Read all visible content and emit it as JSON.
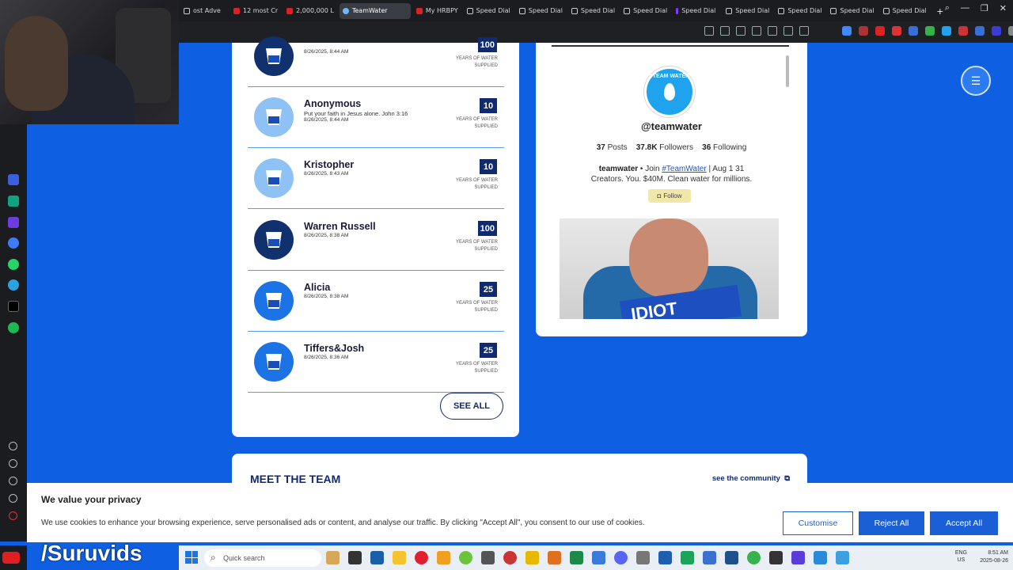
{
  "browser": {
    "tabs": [
      {
        "label": "ost Adve",
        "icon": "grid"
      },
      {
        "label": "12 most Cr",
        "icon": "red"
      },
      {
        "label": "2,000,000 L",
        "icon": "red"
      },
      {
        "label": "TeamWater",
        "icon": "blue",
        "active": true
      },
      {
        "label": "My HRBPY",
        "icon": "red"
      },
      {
        "label": "Speed Dial",
        "icon": "grid"
      },
      {
        "label": "Speed Dial",
        "icon": "grid"
      },
      {
        "label": "Speed Dial",
        "icon": "grid"
      },
      {
        "label": "Speed Dial",
        "icon": "grid"
      },
      {
        "label": "Speed Dial",
        "icon": "purple"
      },
      {
        "label": "Speed Dial",
        "icon": "grid"
      },
      {
        "label": "Speed Dial",
        "icon": "grid"
      },
      {
        "label": "Speed Dial",
        "icon": "grid"
      },
      {
        "label": "Speed Dial",
        "icon": "grid"
      }
    ],
    "new_tab": "+"
  },
  "donations": {
    "unit_label": "YEARS OF WATER SUPPLIED",
    "items": [
      {
        "name": "",
        "message": "",
        "date": "8/26/2025, 8:44 AM",
        "amount": "100",
        "avatar": "dark"
      },
      {
        "name": "Anonymous",
        "message": "Put your faith in Jesus alone. John 3:16",
        "date": "8/26/2025, 8:44 AM",
        "amount": "10",
        "avatar": "light"
      },
      {
        "name": "Kristopher",
        "message": "",
        "date": "8/26/2025, 8:43 AM",
        "amount": "10",
        "avatar": "light"
      },
      {
        "name": "Warren Russell",
        "message": "",
        "date": "8/26/2025, 8:38 AM",
        "amount": "100",
        "avatar": "dark"
      },
      {
        "name": "Alicia",
        "message": "",
        "date": "8/26/2025, 8:38 AM",
        "amount": "25",
        "avatar": "mid"
      },
      {
        "name": "Tiffers&Josh",
        "message": "",
        "date": "8/26/2025, 8:36 AM",
        "amount": "25",
        "avatar": "mid"
      }
    ],
    "see_all": "SEE ALL"
  },
  "instagram": {
    "logo_text": "#TEAM WATER",
    "handle": "@teamwater",
    "posts": "37",
    "posts_label": "Posts",
    "followers": "37.8K",
    "followers_label": "Followers",
    "following": "36",
    "following_label": "Following",
    "bio_name": "teamwater",
    "bio_join": " • Join ",
    "bio_tag": "#TeamWater",
    "bio_dates": " | Aug 1 31",
    "bio_line2": "Creators. You. $40M. Clean water for millions.",
    "follow_label": "Follow",
    "photo_sign": "IDIOT"
  },
  "team": {
    "title": "MEET THE TEAM",
    "link": "see the community"
  },
  "cookie": {
    "title": "We value your privacy",
    "text": "We use cookies to enhance your browsing experience, serve personalised ads or content, and analyse our traffic. By clicking \"Accept All\", you consent to our use of cookies.",
    "customise": "Customise",
    "reject": "Reject All",
    "accept": "Accept All"
  },
  "watermark": "/Suruvids",
  "taskbar": {
    "search_placeholder": "Quick search",
    "lang1": "ENG",
    "lang2": "US",
    "time": "8:51 AM",
    "date": "2025-08-26"
  },
  "colors": {
    "page_bg": "#0f5fe3",
    "navy": "#0f2a70",
    "button_blue": "#1a5fd6"
  }
}
